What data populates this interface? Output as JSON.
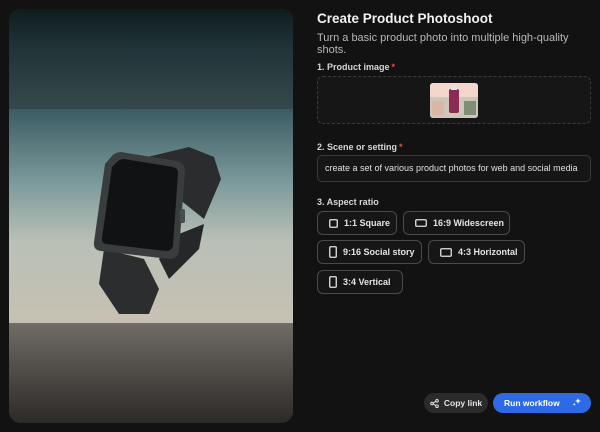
{
  "header": {
    "title": "Create Product Photoshoot",
    "subtitle": "Turn a basic product photo into multiple high-quality shots."
  },
  "form": {
    "product_image": {
      "label": "1. Product image",
      "required": "*"
    },
    "scene": {
      "label": "2. Scene or setting",
      "required": "*",
      "value": "create a set of various product photos for web and social media"
    },
    "aspect_ratio": {
      "label": "3. Aspect ratio",
      "options": [
        {
          "label": "1:1 Square",
          "icon": "square-icon"
        },
        {
          "label": "16:9 Widescreen",
          "icon": "landscape-icon"
        },
        {
          "label": "9:16 Social story",
          "icon": "portrait-icon"
        },
        {
          "label": "4:3 Horizontal",
          "icon": "landscape-icon"
        },
        {
          "label": "3:4 Vertical",
          "icon": "portrait-icon"
        }
      ]
    }
  },
  "actions": {
    "copy_link": "Copy link",
    "run_workflow": "Run workflow"
  },
  "colors": {
    "background": "#121212",
    "accent": "#2f6ae6",
    "required": "#e5534b"
  }
}
